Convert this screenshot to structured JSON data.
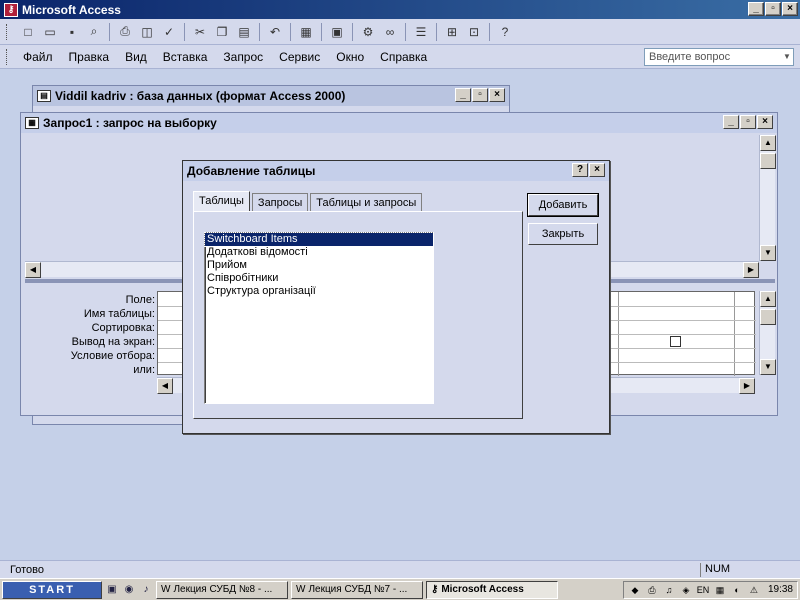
{
  "app": {
    "title": "Microsoft Access",
    "min": "_",
    "max": "▫",
    "close": "×"
  },
  "toolbar": {
    "icons": [
      "new-icon",
      "open-icon",
      "save-icon",
      "search-icon",
      "print-icon",
      "preview-icon",
      "spell-icon",
      "cut-icon",
      "copy-icon",
      "paste-icon",
      "undo-icon",
      "query-type-icon",
      "show-table-icon",
      "build-icon",
      "relationships-icon",
      "properties-icon",
      "database-window-icon",
      "new-object-icon",
      "help-icon"
    ]
  },
  "menu": {
    "items": [
      "Файл",
      "Правка",
      "Вид",
      "Вставка",
      "Запрос",
      "Сервис",
      "Окно",
      "Справка"
    ],
    "ask_placeholder": "Введите вопрос"
  },
  "db_window": {
    "title": "Viddil kadriv : база данных (формат Access 2000)"
  },
  "query_window": {
    "title": "Запрос1 : запрос на выборку",
    "row_labels": [
      "Поле:",
      "Имя таблицы:",
      "Сортировка:",
      "Вывод на экран:",
      "Условие отбора:",
      "или:"
    ]
  },
  "dialog": {
    "title": "Добавление таблицы",
    "help": "?",
    "close": "×",
    "tabs": [
      "Таблицы",
      "Запросы",
      "Таблицы и запросы"
    ],
    "active_tab": 0,
    "items": [
      "Switchboard Items",
      "Додаткові відомості",
      "Прийом",
      "Співробітники",
      "Структура організації"
    ],
    "selected_index": 0,
    "add_button": "Добавить",
    "close_button": "Закрыть"
  },
  "statusbar": {
    "text": "Готово",
    "num": "NUM"
  },
  "taskbar": {
    "start": "START",
    "tasks": [
      {
        "label": "Лекция СУБД №8 - ...",
        "active": false
      },
      {
        "label": "Лекция СУБД №7 - ...",
        "active": false
      },
      {
        "label": "Microsoft Access",
        "active": true
      }
    ],
    "lang": "EN",
    "clock": "19:38"
  }
}
